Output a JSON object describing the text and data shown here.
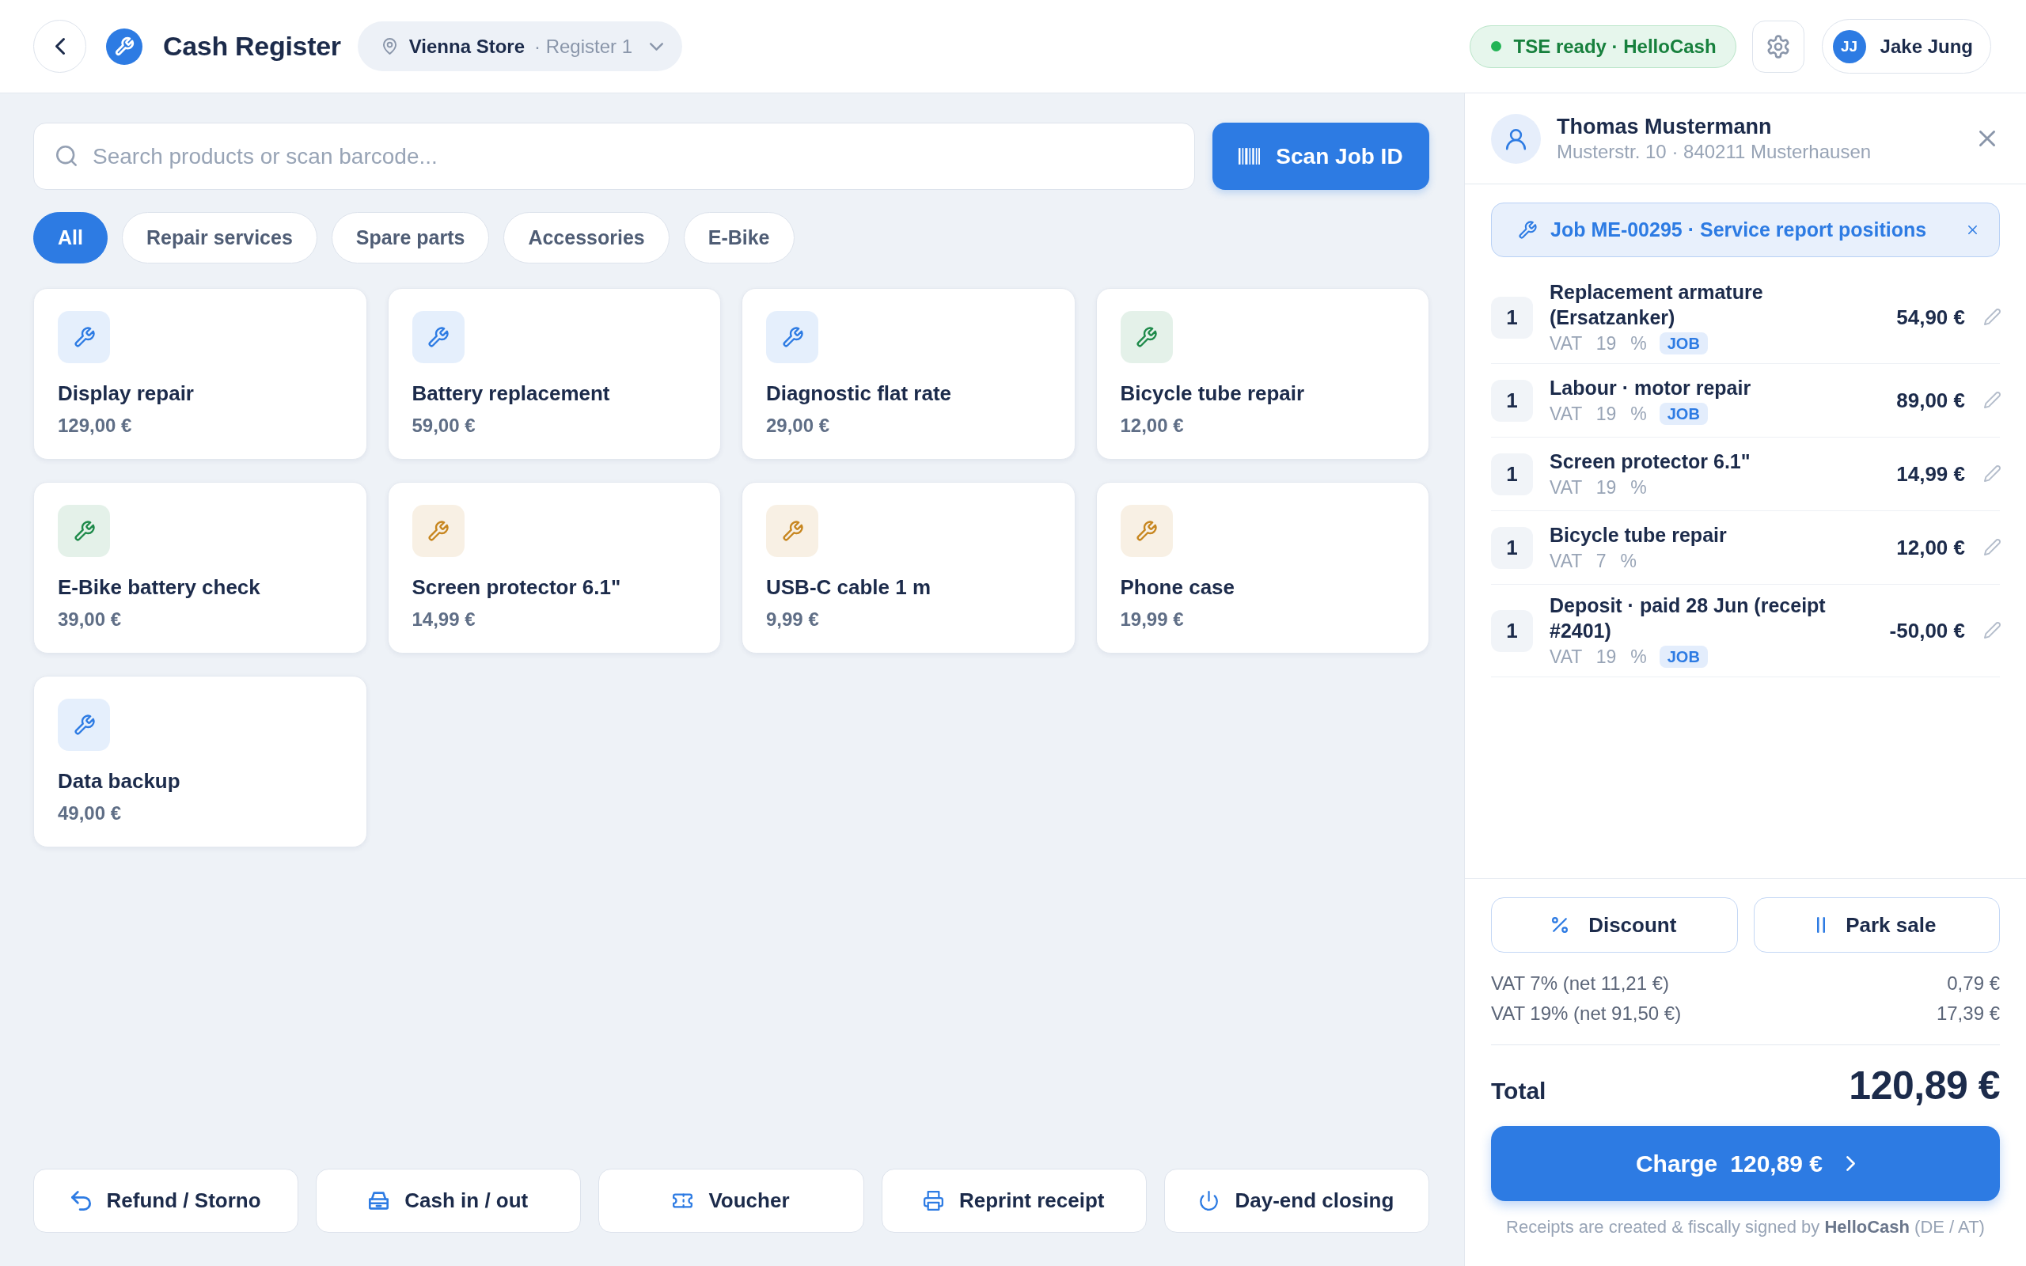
{
  "header": {
    "title": "Cash Register",
    "store": {
      "name": "Vienna Store",
      "register": "· Register 1"
    },
    "status": "TSE ready · HelloCash",
    "user": {
      "initials": "JJ",
      "name": "Jake Jung"
    }
  },
  "search": {
    "placeholder": "Search products or scan barcode..."
  },
  "scan_button": "Scan Job ID",
  "categories": [
    {
      "label": "All",
      "selected": true
    },
    {
      "label": "Repair services",
      "selected": false
    },
    {
      "label": "Spare parts",
      "selected": false
    },
    {
      "label": "Accessories",
      "selected": false
    },
    {
      "label": "E-Bike",
      "selected": false
    }
  ],
  "products": [
    {
      "name": "Display repair",
      "price": "129,00 €",
      "color": "#2d7be3"
    },
    {
      "name": "Battery replacement",
      "price": "59,00 €",
      "color": "#2d7be3"
    },
    {
      "name": "Diagnostic flat rate",
      "price": "29,00 €",
      "color": "#2d7be3"
    },
    {
      "name": "Bicycle tube repair",
      "price": "12,00 €",
      "color": "#1e8a4a"
    },
    {
      "name": "E-Bike battery check",
      "price": "39,00 €",
      "color": "#1e8a4a"
    },
    {
      "name": "Screen protector 6.1\"",
      "price": "14,99 €",
      "color": "#c7861f"
    },
    {
      "name": "USB-C cable 1 m",
      "price": "9,99 €",
      "color": "#c7861f"
    },
    {
      "name": "Phone case",
      "price": "19,99 €",
      "color": "#c7861f"
    },
    {
      "name": "Data backup",
      "price": "49,00 €",
      "color": "#2d7be3"
    }
  ],
  "actions": [
    "Refund / Storno",
    "Cash in / out",
    "Voucher",
    "Reprint receipt",
    "Day-end closing"
  ],
  "customer": {
    "name": "Thomas Mustermann",
    "address": "Musterstr. 10 · 840211 Musterhausen"
  },
  "job_banner": "Job ME-00295 · Service report positions",
  "cart": [
    {
      "qty": "1",
      "name": "Replacement armature (Ersatzanker)",
      "vat": "VAT 19 %",
      "badge": "JOB",
      "price": "54,90 €"
    },
    {
      "qty": "1",
      "name": "Labour · motor repair",
      "vat": "VAT 19 %",
      "badge": "JOB",
      "price": "89,00 €"
    },
    {
      "qty": "1",
      "name": "Screen protector 6.1\"",
      "vat": "VAT 19 %",
      "price": "14,99 €"
    },
    {
      "qty": "1",
      "name": "Bicycle tube repair",
      "vat": "VAT 7 %",
      "price": "12,00 €"
    },
    {
      "qty": "1",
      "name": "Deposit · paid 28 Jun (receipt #2401)",
      "vat": "VAT 19 %",
      "badge": "JOB",
      "price": "-50,00 €"
    }
  ],
  "cart_actions": [
    "Discount",
    "Park sale"
  ],
  "tax_lines": [
    {
      "label": "VAT 7% (net 11,21 €)",
      "amount": "0,79 €"
    },
    {
      "label": "VAT 19% (net 91,50 €)",
      "amount": "17,39 €"
    }
  ],
  "total": {
    "label": "Total",
    "amount": "120,89 €"
  },
  "charge_button": {
    "label": "Charge",
    "amount": "120,89 €"
  },
  "footnote": "Receipts are created & fiscally signed by **HelloCash** (DE / AT)"
}
